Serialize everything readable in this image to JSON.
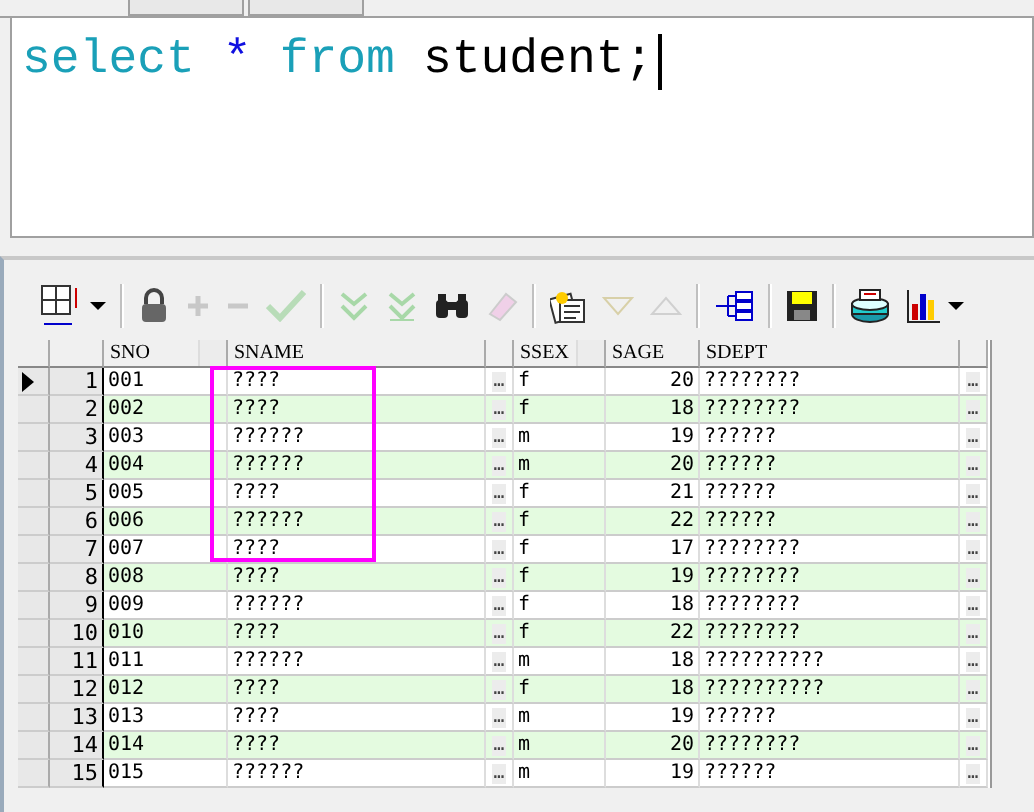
{
  "editor": {
    "tokens": [
      {
        "text": "select",
        "kind": "keyword"
      },
      {
        "text": "*",
        "kind": "operator"
      },
      {
        "text": "from",
        "kind": "keyword"
      },
      {
        "text": "student;",
        "kind": "identifier"
      }
    ]
  },
  "toolbar": [
    {
      "kind": "grid",
      "disabled": false,
      "dropdown": true
    },
    {
      "kind": "lock",
      "disabled": false,
      "dropdown": false
    },
    {
      "kind": "plus",
      "disabled": true,
      "dropdown": false
    },
    {
      "kind": "minus",
      "disabled": true,
      "dropdown": false
    },
    {
      "kind": "check",
      "disabled": true,
      "dropdown": false
    },
    {
      "kind": "down2",
      "disabled": true,
      "dropdown": false
    },
    {
      "kind": "down2b",
      "disabled": true,
      "dropdown": false
    },
    {
      "kind": "binoculars",
      "disabled": false,
      "dropdown": false
    },
    {
      "kind": "eraser",
      "disabled": true,
      "dropdown": false
    },
    {
      "kind": "notes",
      "disabled": false,
      "dropdown": false
    },
    {
      "kind": "tridown",
      "disabled": true,
      "dropdown": false
    },
    {
      "kind": "triup",
      "disabled": true,
      "dropdown": false
    },
    {
      "kind": "tree",
      "disabled": false,
      "dropdown": false
    },
    {
      "kind": "save",
      "disabled": false,
      "dropdown": false
    },
    {
      "kind": "drive",
      "disabled": false,
      "dropdown": false
    },
    {
      "kind": "chart",
      "disabled": false,
      "dropdown": true
    }
  ],
  "table": {
    "columns": [
      "SNO",
      "SNAME",
      "SSEX",
      "SAGE",
      "SDEPT"
    ],
    "rows": [
      {
        "num": "1",
        "sno": "001",
        "sname": "????",
        "ssex": "f",
        "sage": "20",
        "sdept": "????????",
        "selected": true
      },
      {
        "num": "2",
        "sno": "002",
        "sname": "????",
        "ssex": "f",
        "sage": "18",
        "sdept": "????????",
        "selected": false
      },
      {
        "num": "3",
        "sno": "003",
        "sname": "??????",
        "ssex": "m",
        "sage": "19",
        "sdept": "??????",
        "selected": false
      },
      {
        "num": "4",
        "sno": "004",
        "sname": "??????",
        "ssex": "m",
        "sage": "20",
        "sdept": "??????",
        "selected": false
      },
      {
        "num": "5",
        "sno": "005",
        "sname": "????",
        "ssex": "f",
        "sage": "21",
        "sdept": "??????",
        "selected": false
      },
      {
        "num": "6",
        "sno": "006",
        "sname": "??????",
        "ssex": "f",
        "sage": "22",
        "sdept": "??????",
        "selected": false
      },
      {
        "num": "7",
        "sno": "007",
        "sname": "????",
        "ssex": "f",
        "sage": "17",
        "sdept": "????????",
        "selected": false
      },
      {
        "num": "8",
        "sno": "008",
        "sname": "????",
        "ssex": "f",
        "sage": "19",
        "sdept": "????????",
        "selected": false
      },
      {
        "num": "9",
        "sno": "009",
        "sname": "??????",
        "ssex": "f",
        "sage": "18",
        "sdept": "????????",
        "selected": false
      },
      {
        "num": "10",
        "sno": "010",
        "sname": "????",
        "ssex": "f",
        "sage": "22",
        "sdept": "????????",
        "selected": false
      },
      {
        "num": "11",
        "sno": "011",
        "sname": "??????",
        "ssex": "m",
        "sage": "18",
        "sdept": "??????????",
        "selected": false
      },
      {
        "num": "12",
        "sno": "012",
        "sname": "????",
        "ssex": "f",
        "sage": "18",
        "sdept": "??????????",
        "selected": false
      },
      {
        "num": "13",
        "sno": "013",
        "sname": "????",
        "ssex": "m",
        "sage": "19",
        "sdept": "??????",
        "selected": false
      },
      {
        "num": "14",
        "sno": "014",
        "sname": "????",
        "ssex": "m",
        "sage": "20",
        "sdept": "????????",
        "selected": false
      },
      {
        "num": "15",
        "sno": "015",
        "sname": "??????",
        "ssex": "m",
        "sage": "19",
        "sdept": "??????",
        "selected": false
      }
    ],
    "ellipsis": "…"
  }
}
